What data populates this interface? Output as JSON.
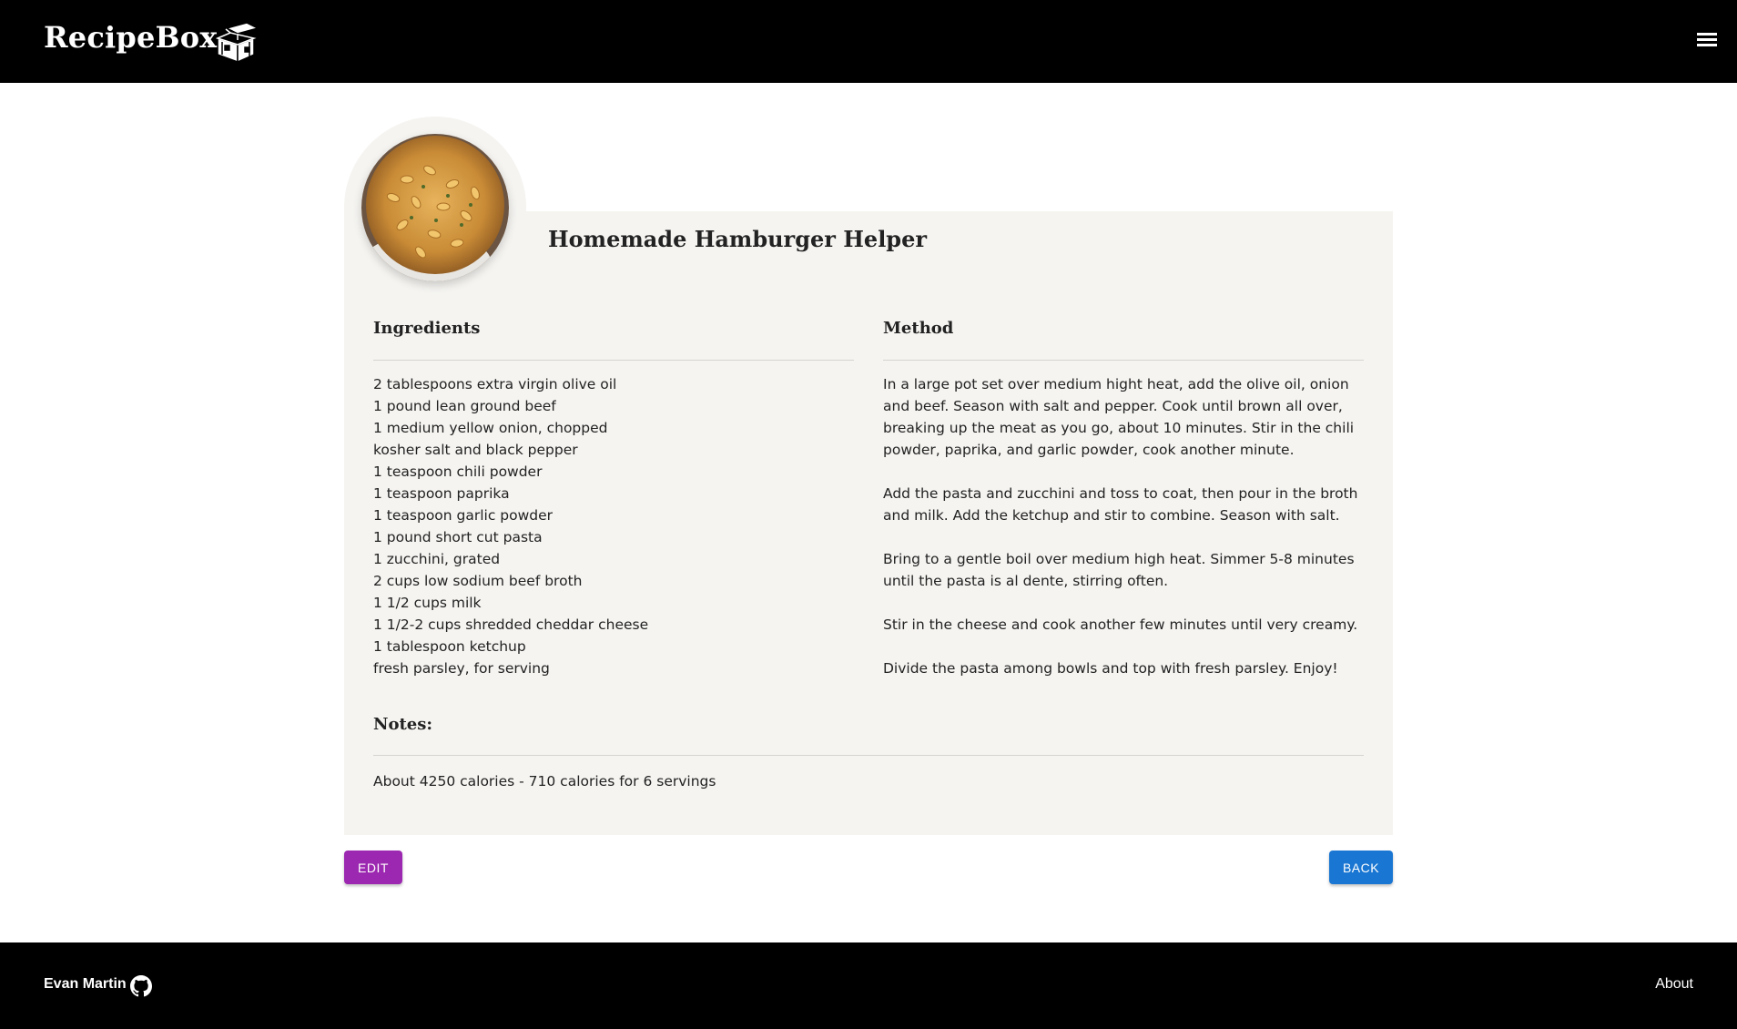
{
  "header": {
    "brand": "RecipeBox",
    "logo_icon": "treasure-box-icon",
    "menu_icon": "hamburger-menu-icon"
  },
  "recipe": {
    "title": "Homemade Hamburger Helper",
    "image": "pasta-dish-photo",
    "ingredients_heading": "Ingredients",
    "ingredients": [
      "2 tablespoons extra virgin olive oil",
      "1 pound lean ground beef",
      "1 medium yellow onion, chopped",
      "kosher salt and black pepper",
      "1 teaspoon chili powder",
      "1 teaspoon paprika",
      "1 teaspoon garlic powder",
      "1 pound short cut pasta",
      "1 zucchini, grated",
      "2 cups low sodium beef broth",
      "1 1/2 cups milk",
      "1 1/2-2 cups shredded cheddar cheese",
      "1 tablespoon ketchup",
      "fresh parsley, for serving"
    ],
    "method_heading": "Method",
    "method": [
      "In a large pot set over medium hight heat, add the olive oil, onion and beef. Season with salt and pepper. Cook until brown all over, breaking up the meat as you go, about 10 minutes. Stir in the chili powder, paprika, and garlic powder, cook another minute.",
      "Add the pasta and zucchini and toss to coat, then pour in the broth and milk. Add the ketchup and stir to combine. Season with salt.",
      "Bring to a gentle boil over medium high heat. Simmer 5-8 minutes until the pasta is al dente, stirring often.",
      "Stir in the cheese and cook another few minutes until very creamy.",
      "Divide the pasta among bowls and top with fresh parsley. Enjoy!"
    ],
    "notes_heading": "Notes:",
    "notes": "About 4250 calories - 710 calories for 6 servings"
  },
  "actions": {
    "edit_label": "EDIT",
    "back_label": "BACK",
    "edit_color": "#9c27b0",
    "back_color": "#1976d2"
  },
  "footer": {
    "author": "Evan Martin",
    "github_icon": "github-icon",
    "about_label": "About"
  }
}
